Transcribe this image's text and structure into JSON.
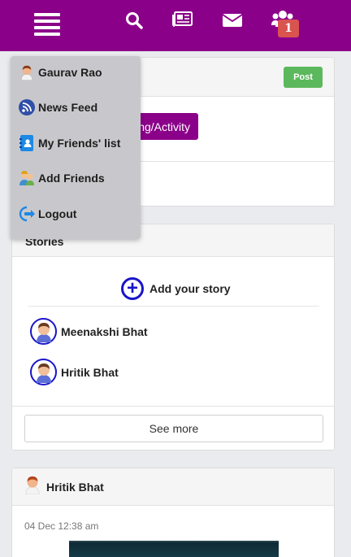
{
  "navbar": {
    "icons": [
      "menu-icon",
      "search-icon",
      "newspaper-icon",
      "envelope-icon",
      "friends-icon"
    ],
    "friends_badge": "1",
    "colors": {
      "bar": "#8b0089",
      "badge": "#d9534f"
    }
  },
  "menu": {
    "items": [
      {
        "label": "Gaurav Rao",
        "icon": "user-avatar-icon"
      },
      {
        "label": "News Feed",
        "icon": "rss-feed-icon"
      },
      {
        "label": "My Friends' list",
        "icon": "contact-book-icon"
      },
      {
        "label": "Add Friends",
        "icon": "add-friends-icon"
      },
      {
        "label": "Logout",
        "icon": "logout-icon"
      }
    ]
  },
  "post_box": {
    "post_label": "Post",
    "feeling_label": "eling/Activity"
  },
  "stories": {
    "title": "Stories",
    "add_story_label": "Add your story",
    "items": [
      {
        "name": "Meenakshi Bhat"
      },
      {
        "name": "Hritik Bhat"
      }
    ],
    "see_more_label": "See more"
  },
  "feed": {
    "author": "Hritik Bhat",
    "time": "04 Dec 12:38 am"
  }
}
